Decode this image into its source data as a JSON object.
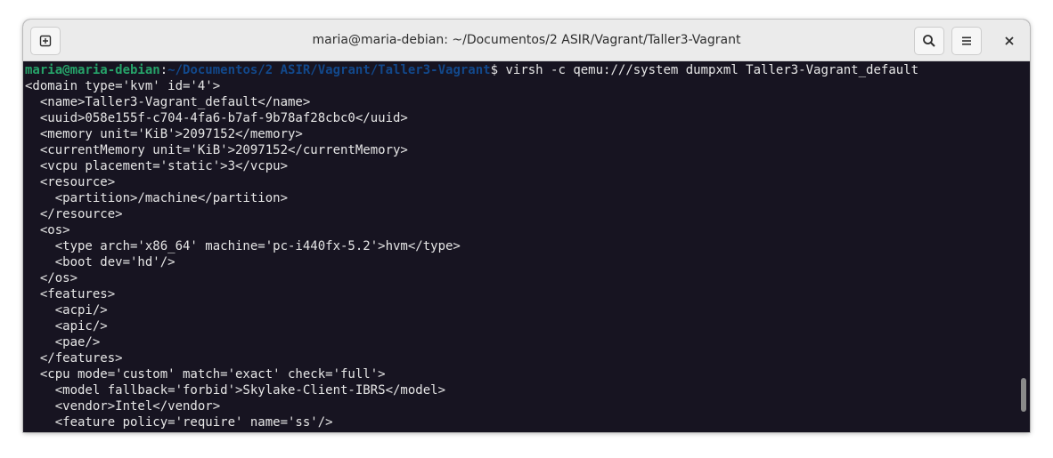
{
  "window": {
    "title": "maria@maria-debian: ~/Documentos/2 ASIR/Vagrant/Taller3-Vagrant"
  },
  "toolbar": {
    "new_tab_icon": "new-tab-icon",
    "search_icon": "search-icon",
    "menu_icon": "hamburger-menu-icon",
    "close_icon": "close-icon"
  },
  "colors": {
    "prompt_user": "#26a269",
    "prompt_path": "#12488b",
    "terminal_bg": "#171421",
    "text": "#e6e6e6"
  },
  "prompt": {
    "user": "maria@maria-debian",
    "separator": ":",
    "path": "~/Documentos/2 ASIR/Vagrant/Taller3-Vagrant",
    "symbol": "$",
    "command": " virsh -c qemu:///system dumpxml Taller3-Vagrant_default"
  },
  "output": [
    "<domain type='kvm' id='4'>",
    "  <name>Taller3-Vagrant_default</name>",
    "  <uuid>058e155f-c704-4fa6-b7af-9b78af28cbc0</uuid>",
    "  <memory unit='KiB'>2097152</memory>",
    "  <currentMemory unit='KiB'>2097152</currentMemory>",
    "  <vcpu placement='static'>3</vcpu>",
    "  <resource>",
    "    <partition>/machine</partition>",
    "  </resource>",
    "  <os>",
    "    <type arch='x86_64' machine='pc-i440fx-5.2'>hvm</type>",
    "    <boot dev='hd'/>",
    "  </os>",
    "  <features>",
    "    <acpi/>",
    "    <apic/>",
    "    <pae/>",
    "  </features>",
    "  <cpu mode='custom' match='exact' check='full'>",
    "    <model fallback='forbid'>Skylake-Client-IBRS</model>",
    "    <vendor>Intel</vendor>",
    "    <feature policy='require' name='ss'/>"
  ]
}
